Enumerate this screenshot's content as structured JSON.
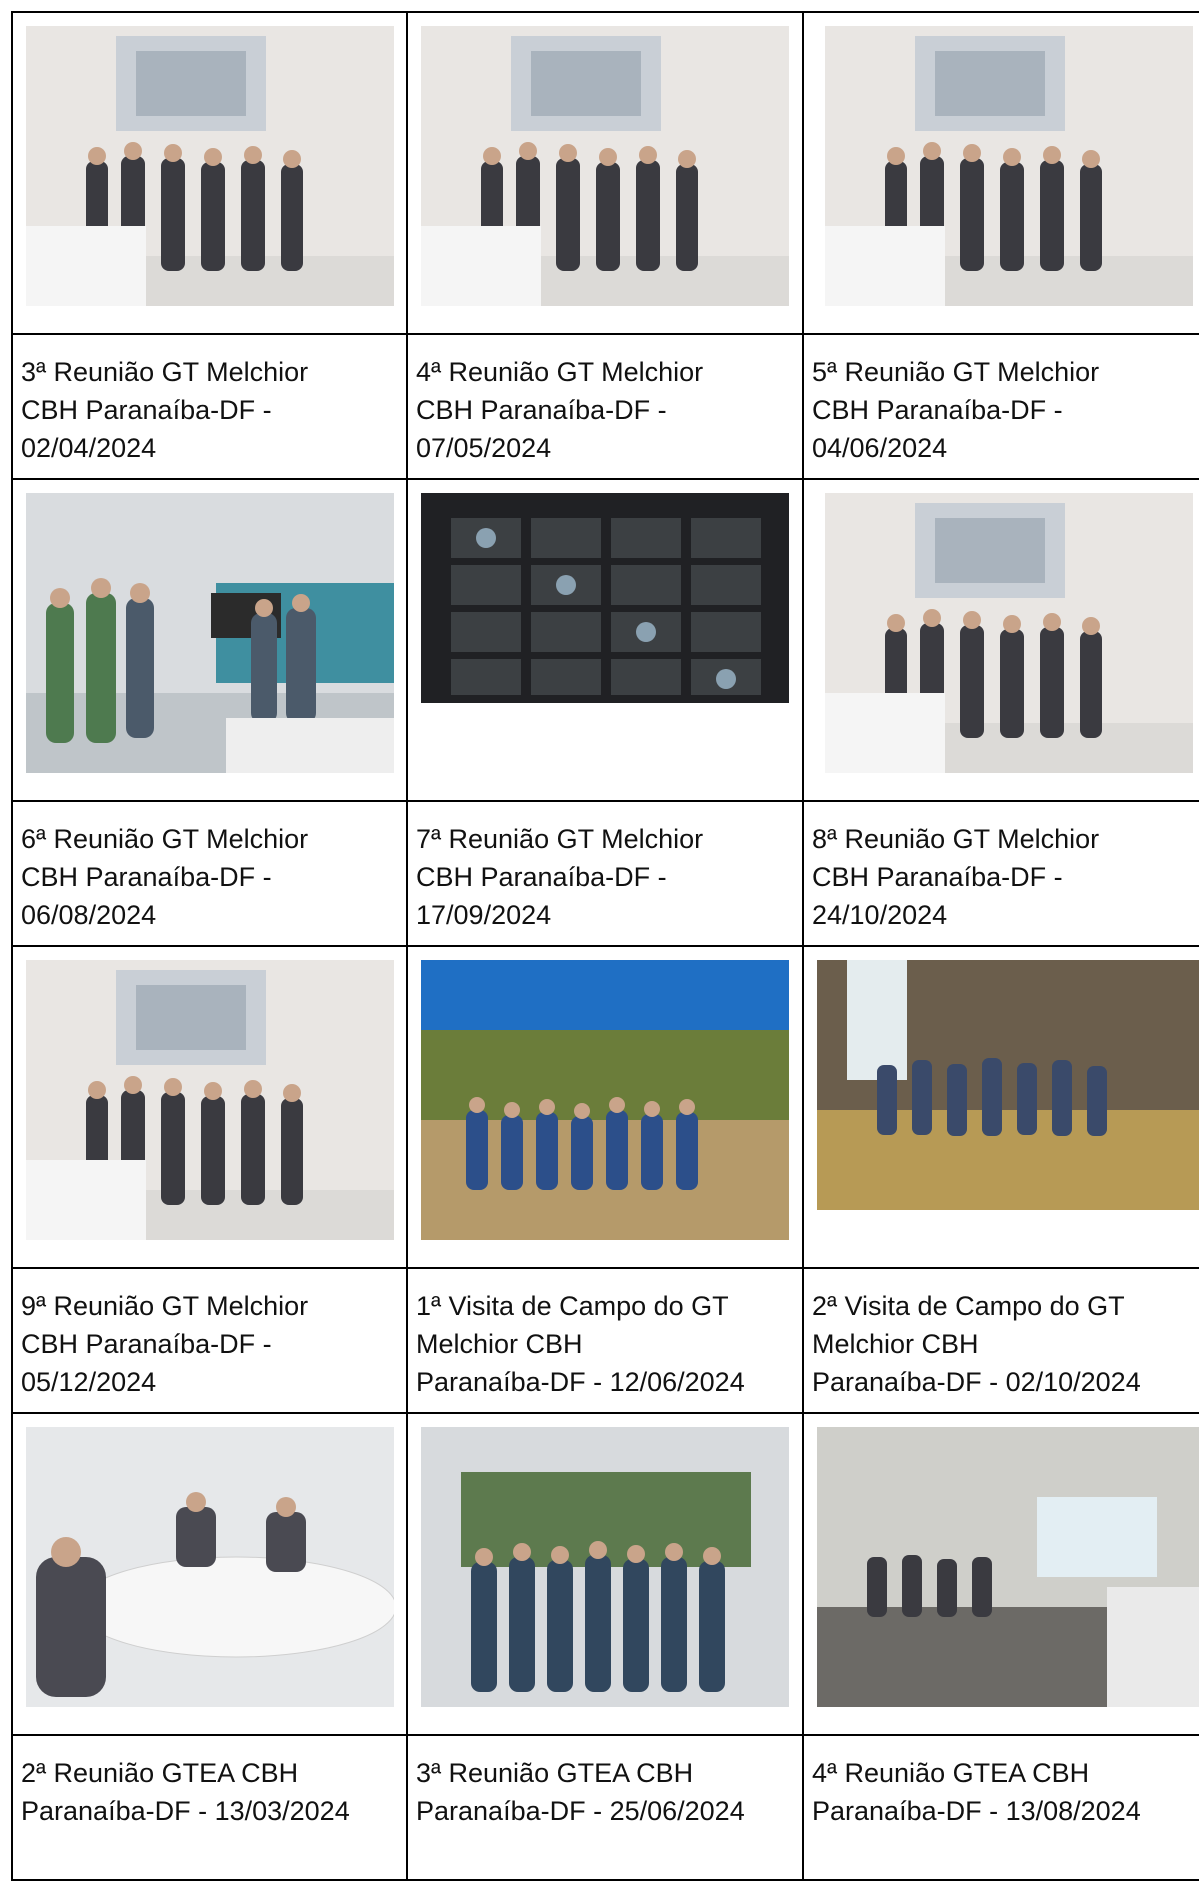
{
  "cells": [
    {
      "caption": "3ª Reunião GT Melchior\nCBH Paranaíba-DF -\n02/04/2024",
      "photo": "meeting-room-group-photo"
    },
    {
      "caption": "4ª Reunião GT Melchior\nCBH Paranaíba-DF -\n07/05/2024",
      "photo": "meeting-room-group-photo"
    },
    {
      "caption": "5ª Reunião GT Melchior\nCBH Paranaíba-DF -\n04/06/2024",
      "photo": "meeting-room-group-photo"
    },
    {
      "caption": "6ª Reunião GT Melchior\nCBH Paranaíba-DF -\n06/08/2024",
      "photo": "office-group-photo"
    },
    {
      "caption": "7ª Reunião GT Melchior\nCBH Paranaíba-DF -\n17/09/2024",
      "photo": "video-call-screenshot"
    },
    {
      "caption": "8ª Reunião GT Melchior\nCBH Paranaíba-DF -\n24/10/2024",
      "photo": "meeting-room-group-photo"
    },
    {
      "caption": "9ª Reunião GT Melchior\nCBH Paranaíba-DF -\n05/12/2024",
      "photo": "meeting-room-group-photo"
    },
    {
      "caption": "1ª Visita de Campo do GT\nMelchior CBH\nParanaíba-DF - 12/06/2024",
      "photo": "field-visit-photo"
    },
    {
      "caption": "2ª Visita de Campo do GT\nMelchior CBH\nParanaíba-DF - 02/10/2024",
      "photo": "waterfall-field-photo"
    },
    {
      "caption": "2ª Reunião GTEA CBH\nParanaíba-DF - 13/03/2024",
      "photo": "meeting-table-photo"
    },
    {
      "caption": "3ª Reunião GTEA CBH\nParanaíba-DF - 25/06/2024",
      "photo": "mural-group-photo"
    },
    {
      "caption": "4ª Reunião GTEA CBH\nParanaíba-DF - 13/08/2024",
      "photo": "meeting-room-photo"
    }
  ]
}
